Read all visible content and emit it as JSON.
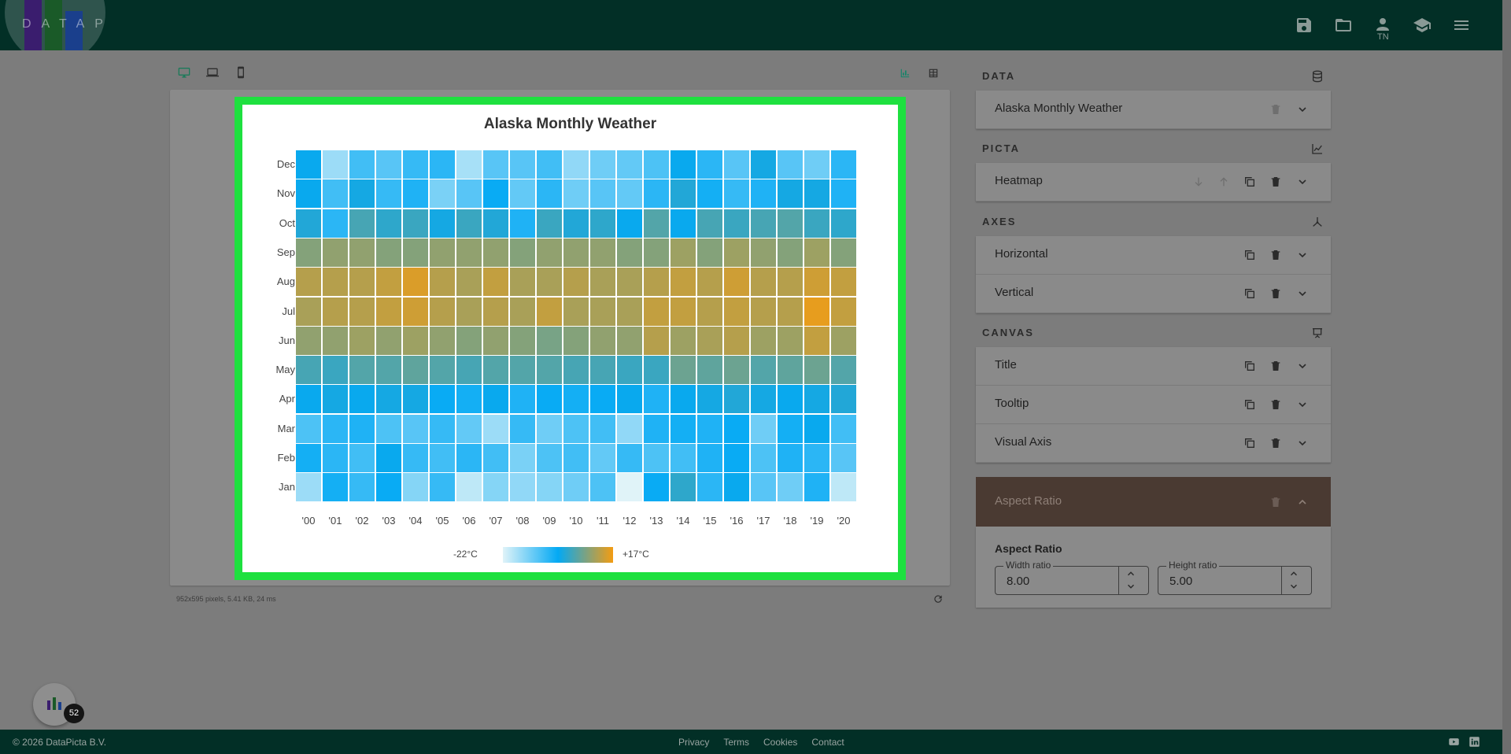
{
  "app": {
    "logo_text": "DATAPICTA",
    "user_initials": "TN",
    "brand_colors": [
      "#4b1f8a",
      "#1e7a2e",
      "#1d4fb5"
    ]
  },
  "toolbar": {
    "devices": [
      "desktop-icon",
      "laptop-icon",
      "mobile-icon"
    ],
    "active_device": "desktop",
    "views": [
      "chart-icon",
      "table-icon"
    ],
    "active_view": "chart"
  },
  "chart_data": {
    "type": "heatmap",
    "title": "Alaska Monthly Weather",
    "x_categories": [
      "'00",
      "'01",
      "'02",
      "'03",
      "'04",
      "'05",
      "'06",
      "'07",
      "'08",
      "'09",
      "'10",
      "'11",
      "'12",
      "'13",
      "'14",
      "'15",
      "'16",
      "'17",
      "'18",
      "'19",
      "'20"
    ],
    "y_categories": [
      "Jan",
      "Feb",
      "Mar",
      "Apr",
      "May",
      "Jun",
      "Jul",
      "Aug",
      "Sep",
      "Oct",
      "Nov",
      "Dec"
    ],
    "unit": "°C",
    "legend_min_label": "-22°C",
    "legend_max_label": "+17°C",
    "value_range": [
      -22,
      17
    ],
    "color_scale": [
      "#e0f3f8",
      "#03a9f4",
      "#f39c12"
    ],
    "values": [
      [
        -16,
        -4,
        -7,
        -3,
        -14,
        -7,
        -19,
        -14,
        -15,
        -14,
        -12,
        -9,
        -22,
        -3,
        1,
        -6,
        -2,
        -10,
        -12,
        -5,
        -19
      ],
      [
        -4,
        -6,
        -8,
        -2,
        -7,
        -8,
        -6,
        -8,
        -13,
        -9,
        -8,
        -11,
        -7,
        -9,
        -8,
        -5,
        -3,
        -9,
        -5,
        -6,
        -10
      ],
      [
        -9,
        -6,
        -5,
        -9,
        -10,
        -7,
        -11,
        -16,
        -7,
        -12,
        -9,
        -8,
        -15,
        -5,
        -4,
        -5,
        -3,
        -12,
        -4,
        -2,
        -8
      ],
      [
        -2,
        -1,
        -2,
        -1,
        -1,
        -3,
        -4,
        -2,
        -5,
        -3,
        -4,
        -3,
        -2,
        -5,
        -2,
        -1,
        0,
        -1,
        -2,
        -1,
        0
      ],
      [
        3,
        2,
        4,
        4,
        5,
        4,
        3,
        4,
        4,
        4,
        3,
        3,
        2,
        2,
        6,
        5,
        6,
        4,
        5,
        6,
        4
      ],
      [
        9,
        9,
        10,
        9,
        10,
        9,
        8,
        9,
        8,
        7,
        8,
        9,
        9,
        12,
        10,
        11,
        12,
        10,
        10,
        13,
        10
      ],
      [
        11,
        12,
        12,
        13,
        14,
        12,
        11,
        12,
        11,
        13,
        11,
        11,
        11,
        13,
        13,
        12,
        13,
        12,
        12,
        16,
        13
      ],
      [
        12,
        12,
        12,
        13,
        15,
        12,
        11,
        13,
        11,
        11,
        12,
        11,
        11,
        12,
        13,
        12,
        14,
        12,
        12,
        14,
        13
      ],
      [
        8,
        9,
        9,
        8,
        8,
        9,
        9,
        9,
        8,
        9,
        9,
        9,
        8,
        8,
        10,
        8,
        10,
        9,
        8,
        10,
        8
      ],
      [
        0,
        -6,
        3,
        1,
        2,
        -1,
        2,
        0,
        -5,
        2,
        0,
        1,
        -2,
        4,
        -2,
        3,
        2,
        3,
        4,
        2,
        1
      ],
      [
        -2,
        -8,
        -1,
        -7,
        -5,
        -13,
        -10,
        -3,
        -11,
        -6,
        -12,
        -10,
        -11,
        -6,
        0,
        -4,
        -7,
        -5,
        -1,
        -1,
        -5
      ],
      [
        -2,
        -16,
        -8,
        -10,
        -7,
        -6,
        -17,
        -10,
        -10,
        -8,
        -15,
        -12,
        -11,
        -9,
        -2,
        -6,
        -10,
        -1,
        -10,
        -12,
        -6
      ]
    ]
  },
  "status": {
    "render_info": "952x595 pixels, 5.41 KB, 24 ms"
  },
  "sidebar": {
    "data": {
      "heading": "DATA",
      "items": [
        {
          "label": "Alaska Monthly Weather"
        }
      ]
    },
    "picta": {
      "heading": "PICTA",
      "items": [
        {
          "label": "Heatmap"
        }
      ]
    },
    "axes": {
      "heading": "AXES",
      "items": [
        {
          "label": "Horizontal"
        },
        {
          "label": "Vertical"
        }
      ]
    },
    "canvas": {
      "heading": "CANVAS",
      "items": [
        {
          "label": "Title"
        },
        {
          "label": "Tooltip"
        },
        {
          "label": "Visual Axis"
        }
      ]
    },
    "aspect_ratio": {
      "header_label": "Aspect Ratio",
      "body_title": "Aspect Ratio",
      "width_label": "Width ratio",
      "width_value": "8.00",
      "height_label": "Height ratio",
      "height_value": "5.00"
    }
  },
  "fab": {
    "badge": "52"
  },
  "footer": {
    "copyright": "© 2026 DataPicta B.V.",
    "links": [
      "Privacy",
      "Terms",
      "Cookies",
      "Contact"
    ]
  }
}
